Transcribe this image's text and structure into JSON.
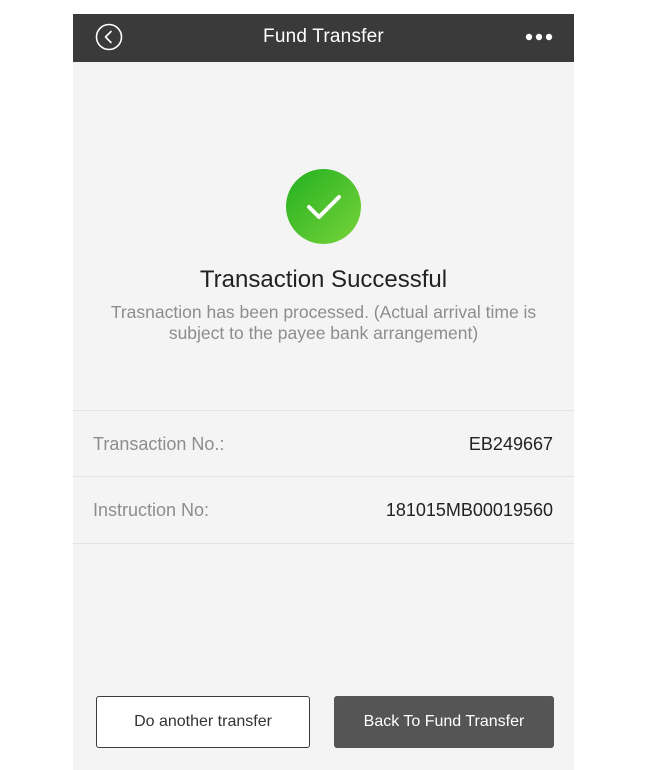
{
  "header": {
    "title": "Fund Transfer",
    "back_icon": "chevron-left-circle-icon",
    "more_icon": "more-horizontal-icon"
  },
  "status": {
    "icon": "checkmark-circle-icon",
    "icon_color": "#3cbd27",
    "title": "Transaction Successful",
    "message": "Trasnaction has been processed. (Actual arrival time is subject to the payee bank arrangement)"
  },
  "details": [
    {
      "label": "Transaction No.:",
      "value": "EB249667"
    },
    {
      "label": "Instruction No:",
      "value": "181015MB00019560"
    }
  ],
  "actions": {
    "secondary_label": "Do another transfer",
    "primary_label": "Back To Fund Transfer"
  },
  "colors": {
    "header_bg": "#3a3a3a",
    "page_bg": "#f4f4f4",
    "primary_button_bg": "#555555",
    "success_green": "#3cbd27"
  }
}
